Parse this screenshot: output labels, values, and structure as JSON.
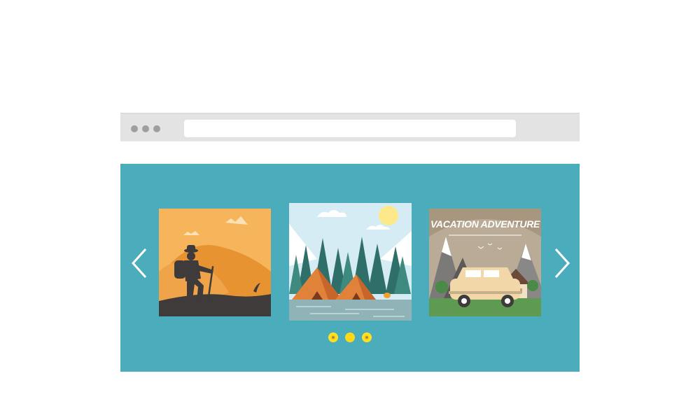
{
  "browser": {
    "window_dots": [
      "dot",
      "dot",
      "dot"
    ],
    "address_bar": {
      "value": ""
    }
  },
  "slider": {
    "background_color": "#4badbb",
    "prev_icon": "chevron-left-icon",
    "next_icon": "chevron-right-icon",
    "slides": [
      {
        "name": "hiker-illustration",
        "caption": ""
      },
      {
        "name": "camping-tents-forest-illustration",
        "caption": ""
      },
      {
        "name": "vacation-adventure-illustration",
        "caption": "VACATION ADVENTURE"
      }
    ],
    "pager": {
      "count": 3,
      "active_index": 1,
      "color": "#ffd81a"
    }
  }
}
